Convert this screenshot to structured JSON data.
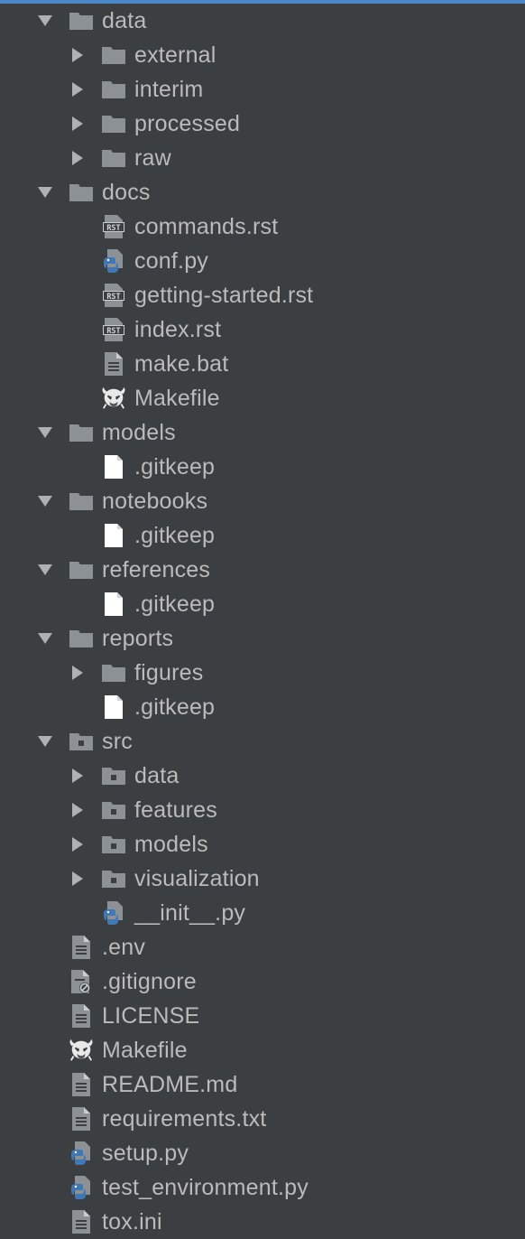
{
  "project_tree": {
    "items": [
      {
        "label": "data",
        "depth": 0,
        "kind": "folder",
        "expanded": true
      },
      {
        "label": "external",
        "depth": 1,
        "kind": "folder",
        "expanded": false
      },
      {
        "label": "interim",
        "depth": 1,
        "kind": "folder",
        "expanded": false
      },
      {
        "label": "processed",
        "depth": 1,
        "kind": "folder",
        "expanded": false
      },
      {
        "label": "raw",
        "depth": 1,
        "kind": "folder",
        "expanded": false
      },
      {
        "label": "docs",
        "depth": 0,
        "kind": "folder",
        "expanded": true
      },
      {
        "label": "commands.rst",
        "depth": 1,
        "kind": "rst"
      },
      {
        "label": "conf.py",
        "depth": 1,
        "kind": "python"
      },
      {
        "label": "getting-started.rst",
        "depth": 1,
        "kind": "rst"
      },
      {
        "label": "index.rst",
        "depth": 1,
        "kind": "rst"
      },
      {
        "label": "make.bat",
        "depth": 1,
        "kind": "text"
      },
      {
        "label": "Makefile",
        "depth": 1,
        "kind": "makefile"
      },
      {
        "label": "models",
        "depth": 0,
        "kind": "folder",
        "expanded": true
      },
      {
        "label": ".gitkeep",
        "depth": 1,
        "kind": "blank"
      },
      {
        "label": "notebooks",
        "depth": 0,
        "kind": "folder",
        "expanded": true
      },
      {
        "label": ".gitkeep",
        "depth": 1,
        "kind": "blank"
      },
      {
        "label": "references",
        "depth": 0,
        "kind": "folder",
        "expanded": true
      },
      {
        "label": ".gitkeep",
        "depth": 1,
        "kind": "blank"
      },
      {
        "label": "reports",
        "depth": 0,
        "kind": "folder",
        "expanded": true
      },
      {
        "label": "figures",
        "depth": 1,
        "kind": "folder",
        "expanded": false
      },
      {
        "label": ".gitkeep",
        "depth": 1,
        "kind": "blank"
      },
      {
        "label": "src",
        "depth": 0,
        "kind": "package",
        "expanded": true
      },
      {
        "label": "data",
        "depth": 1,
        "kind": "package",
        "expanded": false
      },
      {
        "label": "features",
        "depth": 1,
        "kind": "package",
        "expanded": false
      },
      {
        "label": "models",
        "depth": 1,
        "kind": "package",
        "expanded": false
      },
      {
        "label": "visualization",
        "depth": 1,
        "kind": "package",
        "expanded": false
      },
      {
        "label": "__init__.py",
        "depth": 1,
        "kind": "python"
      },
      {
        "label": ".env",
        "depth": 0,
        "kind": "text"
      },
      {
        "label": ".gitignore",
        "depth": 0,
        "kind": "ignore"
      },
      {
        "label": "LICENSE",
        "depth": 0,
        "kind": "text"
      },
      {
        "label": "Makefile",
        "depth": 0,
        "kind": "makefile"
      },
      {
        "label": "README.md",
        "depth": 0,
        "kind": "text"
      },
      {
        "label": "requirements.txt",
        "depth": 0,
        "kind": "text"
      },
      {
        "label": "setup.py",
        "depth": 0,
        "kind": "python"
      },
      {
        "label": "test_environment.py",
        "depth": 0,
        "kind": "python"
      },
      {
        "label": "tox.ini",
        "depth": 0,
        "kind": "text"
      }
    ]
  },
  "colors": {
    "background": "#3c3f41",
    "text": "#bbbbbb",
    "folder": "#8c9196",
    "arrow": "#aeb1b4",
    "accent": "#4a88c7",
    "python_blue": "#3f78b4",
    "python_yellow": "#f2c94c"
  }
}
